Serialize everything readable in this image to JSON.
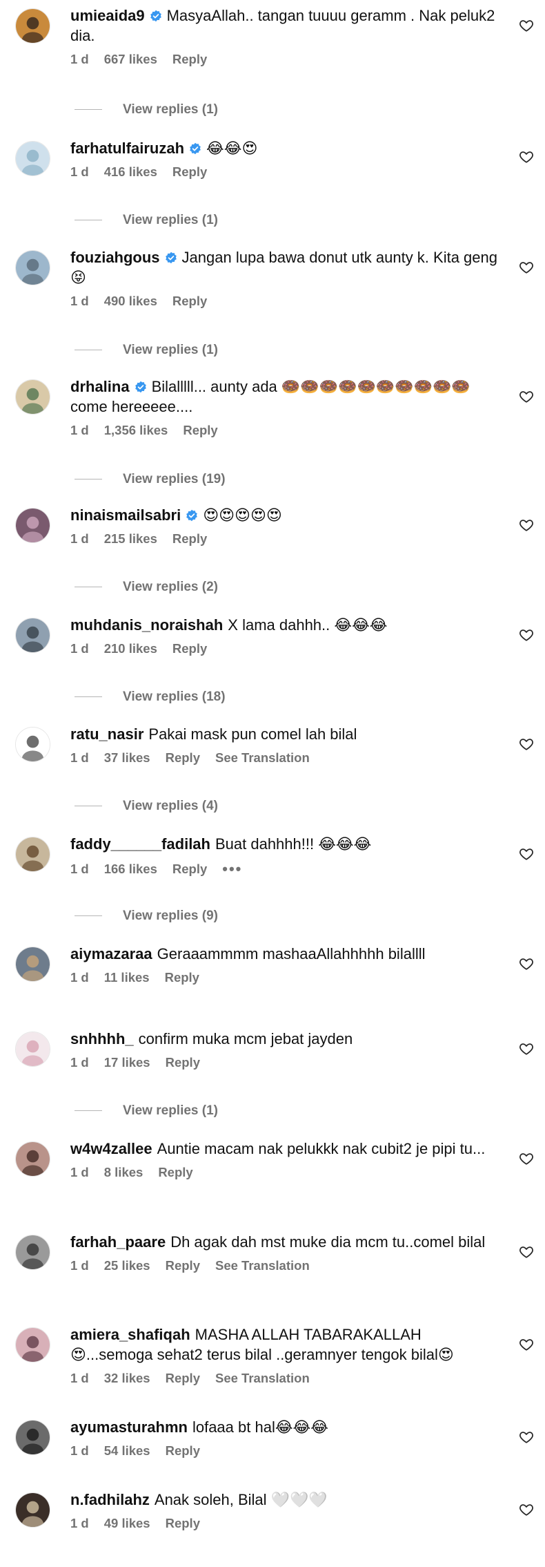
{
  "comments": [
    {
      "username": "umieaida9",
      "verified": true,
      "text": "MasyaAllah.. tangan tuuuu geramm . Nak peluk2 dia.",
      "time": "1 d",
      "likes": "667 likes",
      "reply": "Reply",
      "extra": null,
      "replies": "View replies (1)",
      "avatar_color": "#c98a3c",
      "avatar_accent": "#3b2a1e"
    },
    {
      "username": "farhatulfairuzah",
      "verified": true,
      "text": "😂😂😍",
      "time": "1 d",
      "likes": "416 likes",
      "reply": "Reply",
      "extra": null,
      "replies": "View replies (1)",
      "avatar_color": "#cfe0ec",
      "avatar_accent": "#8fb4c9"
    },
    {
      "username": "fouziahgous",
      "verified": true,
      "text": "Jangan lupa bawa donut utk aunty k. Kita geng😝",
      "time": "1 d",
      "likes": "490 likes",
      "reply": "Reply",
      "extra": null,
      "replies": "View replies (1)",
      "avatar_color": "#9db7cc",
      "avatar_accent": "#5d6e7c"
    },
    {
      "username": "drhalina",
      "verified": true,
      "text": "Bilalllll... aunty ada 🍩🍩🍩🍩🍩🍩🍩🍩🍩🍩 come hereeeee....",
      "time": "1 d",
      "likes": "1,356 likes",
      "reply": "Reply",
      "extra": null,
      "replies": "View replies (19)",
      "avatar_color": "#d9c9a8",
      "avatar_accent": "#5a7a56"
    },
    {
      "username": "ninaismailsabri",
      "verified": true,
      "text": "😍😍😍😍😍",
      "time": "1 d",
      "likes": "215 likes",
      "reply": "Reply",
      "extra": null,
      "replies": "View replies (2)",
      "avatar_color": "#7a5a6e",
      "avatar_accent": "#c9a2b8"
    },
    {
      "username": "muhdanis_noraishah",
      "verified": false,
      "text": "X lama dahhh.. 😂😂😂",
      "time": "1 d",
      "likes": "210 likes",
      "reply": "Reply",
      "extra": null,
      "replies": "View replies (18)",
      "avatar_color": "#8fa0b0",
      "avatar_accent": "#3c4650"
    },
    {
      "username": "ratu_nasir",
      "verified": false,
      "text": "Pakai mask pun comel lah bilal",
      "time": "1 d",
      "likes": "37 likes",
      "reply": "Reply",
      "extra": "See Translation",
      "replies": "View replies (4)",
      "avatar_color": "#ffffff",
      "avatar_accent": "#555555"
    },
    {
      "username": "faddy______fadilah",
      "verified": false,
      "text": "Buat dahhhh!!! 😂😂😂",
      "time": "1 d",
      "likes": "166 likes",
      "reply": "Reply",
      "extra": "•••",
      "replies": "View replies (9)",
      "avatar_color": "#c7b79c",
      "avatar_accent": "#6a4f33"
    },
    {
      "username": "aiymazaraa",
      "verified": false,
      "text": "Geraaammmm mashaaAllahhhhh bilallll",
      "time": "1 d",
      "likes": "11 likes",
      "reply": "Reply",
      "extra": null,
      "replies": null,
      "avatar_color": "#6e7c8c",
      "avatar_accent": "#c2a27a"
    },
    {
      "username": "snhhhh_",
      "verified": false,
      "text": "confirm muka mcm jebat jayden",
      "time": "1 d",
      "likes": "17 likes",
      "reply": "Reply",
      "extra": null,
      "replies": "View replies (1)",
      "avatar_color": "#f3e8ec",
      "avatar_accent": "#d9a7b6"
    },
    {
      "username": "w4w4zallee",
      "verified": false,
      "text": "Auntie macam nak pelukkk nak cubit2 je pipi tu...",
      "time": "1 d",
      "likes": "8 likes",
      "reply": "Reply",
      "extra": null,
      "replies": null,
      "avatar_color": "#b9938a",
      "avatar_accent": "#4a302a"
    },
    {
      "username": "farhah_paare",
      "verified": false,
      "text": "Dh agak dah mst muke dia mcm tu..comel bilal",
      "time": "1 d",
      "likes": "25 likes",
      "reply": "Reply",
      "extra": "See Translation",
      "replies": null,
      "avatar_color": "#9a9a9a",
      "avatar_accent": "#3a3a3a"
    },
    {
      "username": "amiera_shafiqah",
      "verified": false,
      "text": "MASHA ALLAH TABARAKALLAH 😍...semoga sehat2 terus bilal ..geramnyer tengok bilal😍",
      "time": "1 d",
      "likes": "32 likes",
      "reply": "Reply",
      "extra": "See Translation",
      "replies": null,
      "avatar_color": "#d8b0b8",
      "avatar_accent": "#6a4450"
    },
    {
      "username": "ayumasturahmn",
      "verified": false,
      "text": "lofaaa bt hal😂😂😂",
      "time": "1 d",
      "likes": "54 likes",
      "reply": "Reply",
      "extra": null,
      "replies": null,
      "avatar_color": "#6b6b6b",
      "avatar_accent": "#1e1e1e"
    },
    {
      "username": "n.fadhilahz",
      "verified": false,
      "text": "Anak soleh, Bilal 🤍🤍🤍",
      "time": "1 d",
      "likes": "49 likes",
      "reply": "Reply",
      "extra": null,
      "replies": null,
      "avatar_color": "#3a2e28",
      "avatar_accent": "#c9b79a"
    }
  ],
  "colors": {
    "verified": "#3897f0",
    "meta": "#737373",
    "text": "#111111"
  },
  "icons": {
    "like": "heart-outline-icon",
    "verified": "verified-badge-icon"
  }
}
